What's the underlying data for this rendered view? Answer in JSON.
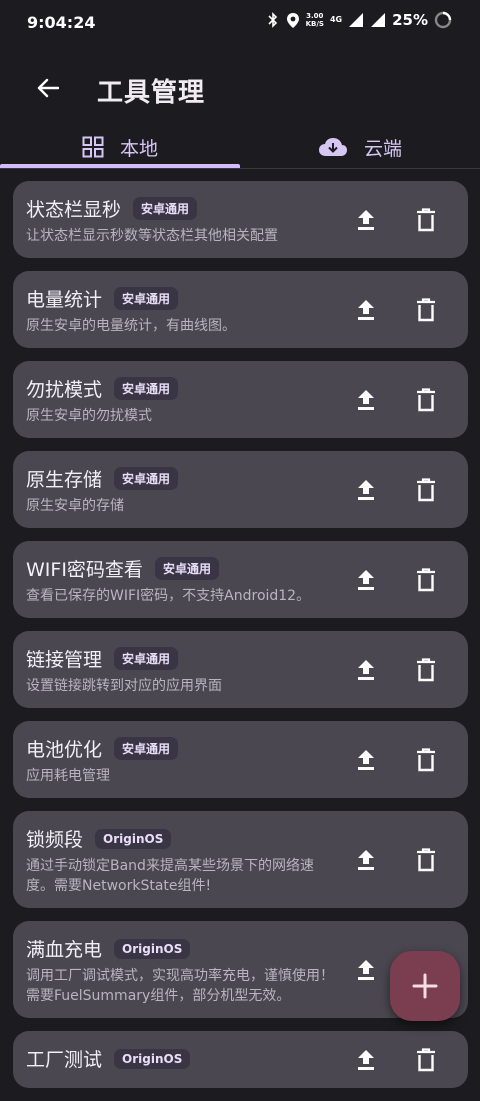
{
  "status": {
    "time": "9:04:24",
    "net_speed_value": "3.00",
    "net_speed_unit": "KB/S",
    "network_type": "4G",
    "battery": "25%"
  },
  "appbar": {
    "title": "工具管理"
  },
  "tabs": [
    {
      "label": "本地",
      "icon": "grid-icon",
      "selected": true
    },
    {
      "label": "云端",
      "icon": "cloud-download-icon",
      "selected": false
    }
  ],
  "tools": [
    {
      "title": "状态栏显秒",
      "tag": "安卓通用",
      "desc": "让状态栏显示秒数等状态栏其他相关配置"
    },
    {
      "title": "电量统计",
      "tag": "安卓通用",
      "desc": "原生安卓的电量统计，有曲线图。"
    },
    {
      "title": "勿扰模式",
      "tag": "安卓通用",
      "desc": "原生安卓的勿扰模式"
    },
    {
      "title": "原生存储",
      "tag": "安卓通用",
      "desc": "原生安卓的存储"
    },
    {
      "title": "WIFI密码查看",
      "tag": "安卓通用",
      "desc": "查看已保存的WIFI密码，不支持Android12。"
    },
    {
      "title": "链接管理",
      "tag": "安卓通用",
      "desc": "设置链接跳转到对应的应用界面"
    },
    {
      "title": "电池优化",
      "tag": "安卓通用",
      "desc": "应用耗电管理"
    },
    {
      "title": "锁频段",
      "tag": "OriginOS",
      "desc": "通过手动锁定Band来提高某些场景下的网络速度。需要NetworkState组件!"
    },
    {
      "title": "满血充电",
      "tag": "OriginOS",
      "desc": "调用工厂调试模式，实现高功率充电，谨慎使用！需要FuelSummary组件，部分机型无效。"
    },
    {
      "title": "工厂测试",
      "tag": "OriginOS",
      "desc": ""
    }
  ],
  "colors": {
    "background": "#1c1b1f",
    "card": "#4a4750",
    "accent": "#d2bcfb",
    "fab": "#7b3d50"
  }
}
